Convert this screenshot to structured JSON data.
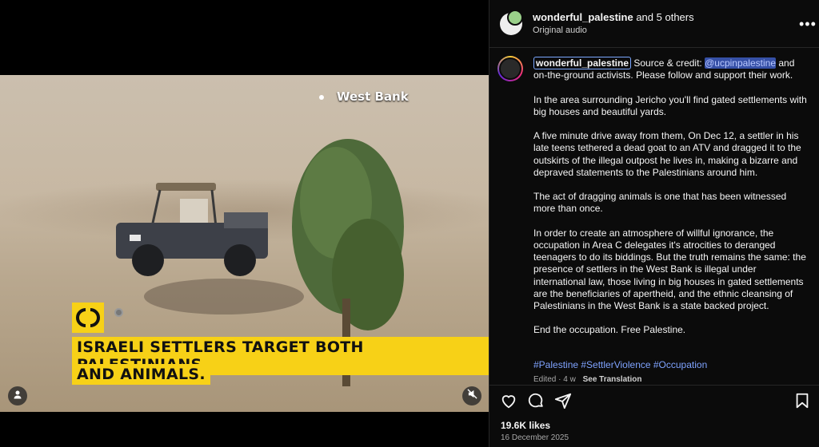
{
  "video": {
    "location_label": "West Bank",
    "caption_line1": "ISRAELI SETTLERS TARGET BOTH PALESTINIANS",
    "caption_line2": "AND ANIMALS."
  },
  "header": {
    "username": "wonderful_palestine",
    "collab_text": "and 5 others",
    "audio": "Original audio"
  },
  "caption": {
    "username": "wonderful_palestine",
    "intro_before": "Source & credit:",
    "mention": "@ucpinpalestine",
    "intro_after": "and on-the-ground activists. Please follow and support their work.",
    "paragraphs": [
      "In the area surrounding Jericho you'll find gated settlements with big houses and beautiful yards.",
      "A five minute drive away from them, On Dec 12, a settler in his late teens tethered a dead goat to an ATV and dragged it to the outskirts of the illegal outpost he lives in, making a bizarre and depraved statements to the Palestinians around him.",
      "The act of dragging animals is one that has been witnessed more than once.",
      "In order to create an atmosphere of willful ignorance, the occupation in Area C delegates it's atrocities to deranged teenagers to do its biddings. But the truth remains the same: the presence of settlers in the West Bank is illegal under international law, those living in big houses in gated settlements are the beneficiaries of apertheid, and the ethnic cleansing of Palestinians in the West Bank is a state backed project.",
      "End the occupation. Free Palestine."
    ],
    "hashtags": "#Palestine #SettlerViolence #Occupation",
    "edited": "Edited · 4 w",
    "see_translation": "See Translation"
  },
  "footer": {
    "likes": "19.6K likes",
    "date": "16 December 2025"
  },
  "icons": [
    "heart-icon",
    "comment-icon",
    "share-icon",
    "bookmark-icon",
    "more-icon",
    "user-icon",
    "mute-icon"
  ],
  "colors": {
    "accent_yellow": "#f7d117",
    "link_blue": "#7fa3ff",
    "panel_bg": "#0b0b0b"
  }
}
